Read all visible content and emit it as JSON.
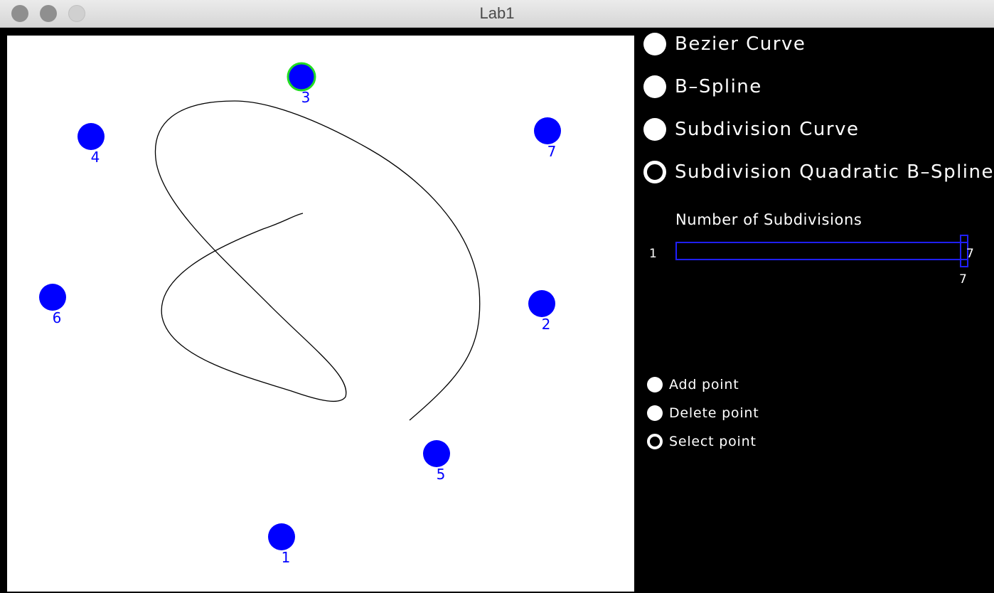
{
  "window": {
    "title": "Lab1"
  },
  "curve_options": [
    {
      "label": "Bezier Curve",
      "selected": false
    },
    {
      "label": "B–Spline",
      "selected": false
    },
    {
      "label": "Subdivision Curve",
      "selected": false
    },
    {
      "label": "Subdivision Quadratic B–Spline",
      "selected": true
    }
  ],
  "subdivisions": {
    "title": "Number of Subdivisions",
    "min": "1",
    "max": "7",
    "value": "7"
  },
  "mode_options": [
    {
      "label": "Add point",
      "selected": false
    },
    {
      "label": "Delete point",
      "selected": false
    },
    {
      "label": "Select point",
      "selected": true
    }
  ],
  "control_points": [
    {
      "label": "1",
      "selected": false
    },
    {
      "label": "2",
      "selected": false
    },
    {
      "label": "3",
      "selected": true
    },
    {
      "label": "4",
      "selected": false
    },
    {
      "label": "5",
      "selected": false
    },
    {
      "label": "6",
      "selected": false
    },
    {
      "label": "7",
      "selected": false
    }
  ],
  "colors": {
    "point": "#0000ff",
    "selected_outline": "#22dd22",
    "curve": "#000000",
    "canvas": "#ffffff",
    "slider": "#1f1fff"
  }
}
